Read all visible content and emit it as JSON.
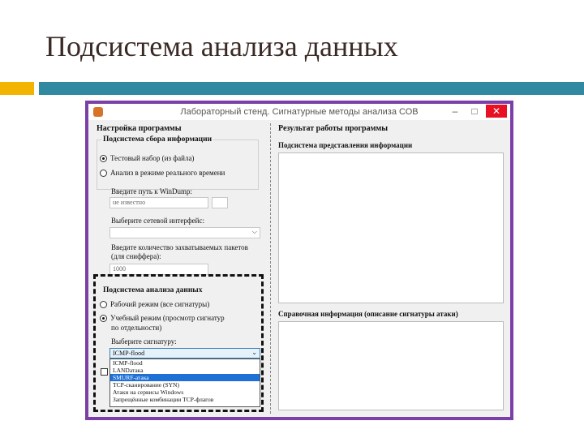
{
  "slide": {
    "title": "Подсистема анализа данных"
  },
  "colors": {
    "accent_left": "#f2b400",
    "accent_right": "#2f8aa1",
    "window_border": "#7b3fa8",
    "selection": "#1e6fd6"
  },
  "window": {
    "title": "Лабораторный стенд. Сигнатурные методы анализа СОВ",
    "buttons": {
      "minimize": "–",
      "maximize": "□",
      "close": "✕"
    }
  },
  "left": {
    "header": "Настройка программы",
    "collection": {
      "title": "Подсистема сбора информации",
      "radio_test": "Тестовый набор (из файла)",
      "radio_realtime": "Анализ в режиме реального времени",
      "windump_label": "Введите путь к WinDump:",
      "windump_value": "не известно",
      "iface_label": "Выберите сетевой интерфейс:",
      "packets_label": "Введите количество захватываемых пакетов",
      "packets_label2": "(для сниффера):",
      "packets_value": "1000"
    },
    "analysis": {
      "title": "Подсистема анализа данных",
      "radio_work": "Рабочий режим (все сигнатуры)",
      "radio_learn": "Учебный режим (просмотр сигнатур",
      "radio_learn2": "по отдельности)",
      "signature_label": "Выберите сигнатуру:",
      "signature_selected": "ICMP-flood",
      "options": [
        "ICMP-flood",
        "LANDатака",
        "SMURF-атака",
        "TCP-сканирование (SYN)",
        "Атаки на сервисы Windows",
        "Запрещённые комбинации TCP-флагов"
      ],
      "highlighted_index": 2
    }
  },
  "right": {
    "header": "Результат работы программы",
    "presentation_title": "Подсистема представления информации",
    "reference_title": "Справочная информация (описание сигнатуры атаки)"
  }
}
